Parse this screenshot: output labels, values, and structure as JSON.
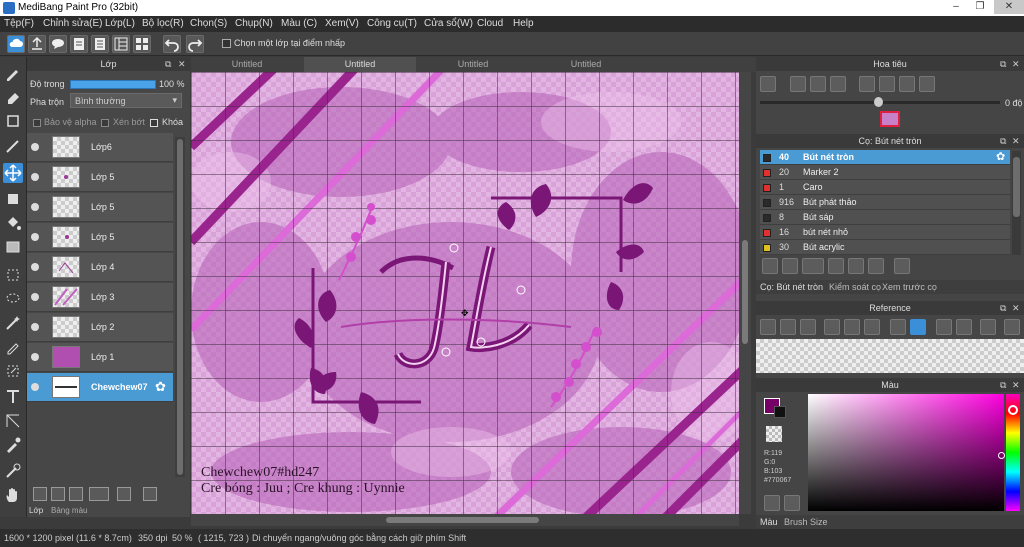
{
  "window": {
    "title": "MediBang Paint Pro (32bit)"
  },
  "menu": [
    "Tệp(F)",
    "Chỉnh sửa(E)",
    "Lớp(L)",
    "Bộ lọc(R)",
    "Chọn(S)",
    "Chụp(N)",
    "Màu (C)",
    "Xem(V)",
    "Công cụ(T)",
    "Cửa sổ(W)",
    "Cloud",
    "Help"
  ],
  "toolbar": {
    "checkbox_label": "Chọn một lớp tại điểm nhấp"
  },
  "layer_panel": {
    "title": "Lớp",
    "opacity_label": "Độ trong",
    "opacity_value": "100 %",
    "opacity": 1.0,
    "blend_label": "Pha trộn",
    "blend_value": "Bình thường",
    "protect_alpha": "Bảo vệ alpha",
    "clipping": "Xén bớt",
    "lock": "Khóa",
    "layers": [
      {
        "name": "Lớp6",
        "selected": false
      },
      {
        "name": "Lớp 5",
        "selected": false
      },
      {
        "name": "Lớp 5",
        "selected": false
      },
      {
        "name": "Lớp 5",
        "selected": false
      },
      {
        "name": "Lớp 4",
        "selected": false
      },
      {
        "name": "Lớp 3",
        "selected": false
      },
      {
        "name": "Lớp 2",
        "selected": false
      },
      {
        "name": "Lớp 1",
        "selected": false
      },
      {
        "name": "Chewchew07",
        "selected": true
      }
    ],
    "tabs": [
      "Lớp",
      "Bảng màu"
    ]
  },
  "documents": {
    "tabs": [
      "Untitled",
      "Untitled",
      "Untitled",
      "Untitled"
    ],
    "active_index": 1
  },
  "canvas": {
    "monogram": "JL",
    "credit_line1": "Chewchew07#hd247",
    "credit_line2": "Cre bóng : Juu ; Cre khung : Uynnie"
  },
  "navigator": {
    "title": "Hoa tiêu",
    "rotation": "0 độ"
  },
  "brush_panel": {
    "title": "Cọ: Bút nét tròn",
    "brushes": [
      {
        "size": "40",
        "name": "Bút nét tròn",
        "color": "#2a2a2a",
        "selected": true
      },
      {
        "size": "20",
        "name": "Marker 2",
        "color": "#e03030",
        "selected": false
      },
      {
        "size": "1",
        "name": "Caro",
        "color": "#e03030",
        "selected": false
      },
      {
        "size": "916",
        "name": "Bút phát thảo",
        "color": "#2a2a2a",
        "selected": false
      },
      {
        "size": "8",
        "name": "Bút sáp",
        "color": "#2a2a2a",
        "selected": false
      },
      {
        "size": "16",
        "name": "bút nét nhỏ",
        "color": "#e03030",
        "selected": false
      },
      {
        "size": "30",
        "name": "Bút acrylic",
        "color": "#e0c020",
        "selected": false
      }
    ],
    "tabs": [
      "Cọ: Bút nét tròn",
      "Kiểm soát cọ",
      "Xem trước cọ"
    ]
  },
  "reference": {
    "title": "Reference"
  },
  "color_panel": {
    "title": "Màu",
    "r": "R:119",
    "g": "G:0",
    "b": "B:103",
    "hex": "#770067",
    "tabs": [
      "Màu",
      "Brush Size"
    ]
  },
  "status": {
    "size": "1600 * 1200 pixel",
    "cm": "(11.6 * 8.7cm)",
    "dpi": "350 dpi",
    "zoom": "50 %",
    "coords": "( 1215, 723 )",
    "hint": "Di chuyển ngang/vuông góc bằng cách giữ phím Shift"
  },
  "colors": {
    "primary": "#770067",
    "accent": "#3a8fd8",
    "canvas_bg": "#d98ed4"
  }
}
